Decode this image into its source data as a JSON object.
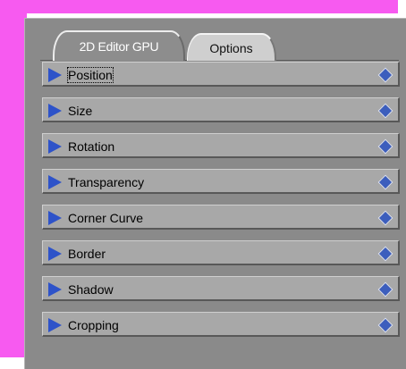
{
  "colors": {
    "magenta": "#f75af0",
    "panel": "#8a8a8a",
    "row": "#a8a8a8",
    "arrow": "#2e53c9",
    "diamond": "#3c5ebd"
  },
  "tabs": [
    {
      "label": "2D Editor GPU",
      "active": true
    },
    {
      "label": "Options",
      "active": false
    }
  ],
  "sections": [
    {
      "label": "Position",
      "focused": true,
      "icon": "triangle-right-icon",
      "keyframe_icon": "diamond-icon"
    },
    {
      "label": "Size",
      "icon": "triangle-right-icon",
      "keyframe_icon": "diamond-icon"
    },
    {
      "label": "Rotation",
      "icon": "triangle-right-icon",
      "keyframe_icon": "diamond-icon"
    },
    {
      "label": "Transparency",
      "icon": "triangle-right-icon",
      "keyframe_icon": "diamond-icon"
    },
    {
      "label": "Corner Curve",
      "icon": "triangle-right-icon",
      "keyframe_icon": "diamond-icon"
    },
    {
      "label": "Border",
      "icon": "triangle-right-icon",
      "keyframe_icon": "diamond-icon"
    },
    {
      "label": "Shadow",
      "icon": "triangle-right-icon",
      "keyframe_icon": "diamond-icon"
    },
    {
      "label": "Cropping",
      "icon": "triangle-right-icon",
      "keyframe_icon": "diamond-icon"
    }
  ]
}
